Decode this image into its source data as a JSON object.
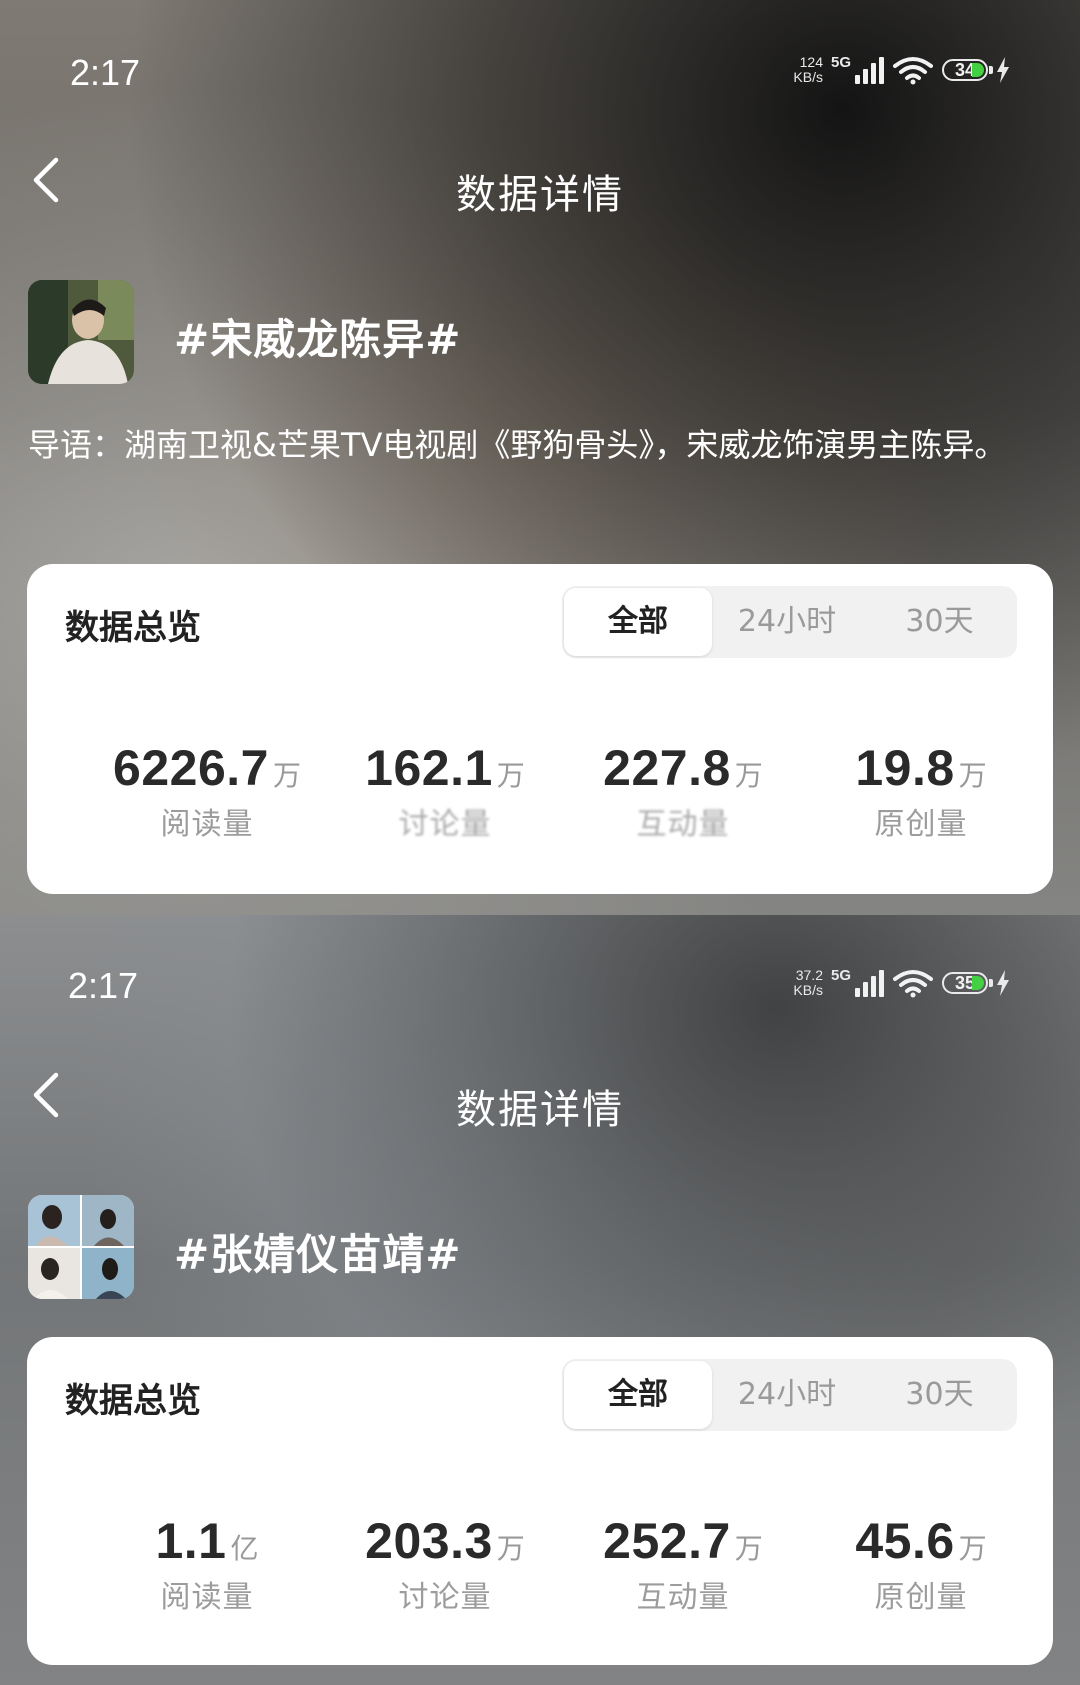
{
  "screens": [
    {
      "status_bar": {
        "time": "2:17",
        "net_speed": "124",
        "net_unit": "KB/s",
        "network": "5G",
        "battery": "34",
        "battery_color": "#43d043"
      },
      "nav": {
        "title": "数据详情",
        "back_icon": "chevron-left-icon"
      },
      "topic": {
        "title": "#宋威龙陈异#",
        "intro": "导语：湖南卫视&芒果TV电视剧《野狗骨头》，宋威龙饰演男主陈异。"
      },
      "overview": {
        "title": "数据总览",
        "tabs": [
          "全部",
          "24小时",
          "30天"
        ],
        "selected_tab": "全部",
        "stats": [
          {
            "value": "6226.7",
            "unit": "万",
            "label": "阅读量"
          },
          {
            "value": "162.1",
            "unit": "万",
            "label": "讨论量"
          },
          {
            "value": "227.8",
            "unit": "万",
            "label": "互动量"
          },
          {
            "value": "19.8",
            "unit": "万",
            "label": "原创量"
          }
        ]
      }
    },
    {
      "status_bar": {
        "time": "2:17",
        "net_speed": "37.2",
        "net_unit": "KB/s",
        "network": "5G",
        "battery": "35",
        "battery_color": "#43d043"
      },
      "nav": {
        "title": "数据详情",
        "back_icon": "chevron-left-icon"
      },
      "topic": {
        "title": "#张婧仪苗靖#"
      },
      "overview": {
        "title": "数据总览",
        "tabs": [
          "全部",
          "24小时",
          "30天"
        ],
        "selected_tab": "全部",
        "stats": [
          {
            "value": "1.1",
            "unit": "亿",
            "label": "阅读量"
          },
          {
            "value": "203.3",
            "unit": "万",
            "label": "讨论量"
          },
          {
            "value": "252.7",
            "unit": "万",
            "label": "互动量"
          },
          {
            "value": "45.6",
            "unit": "万",
            "label": "原创量"
          }
        ]
      }
    }
  ]
}
